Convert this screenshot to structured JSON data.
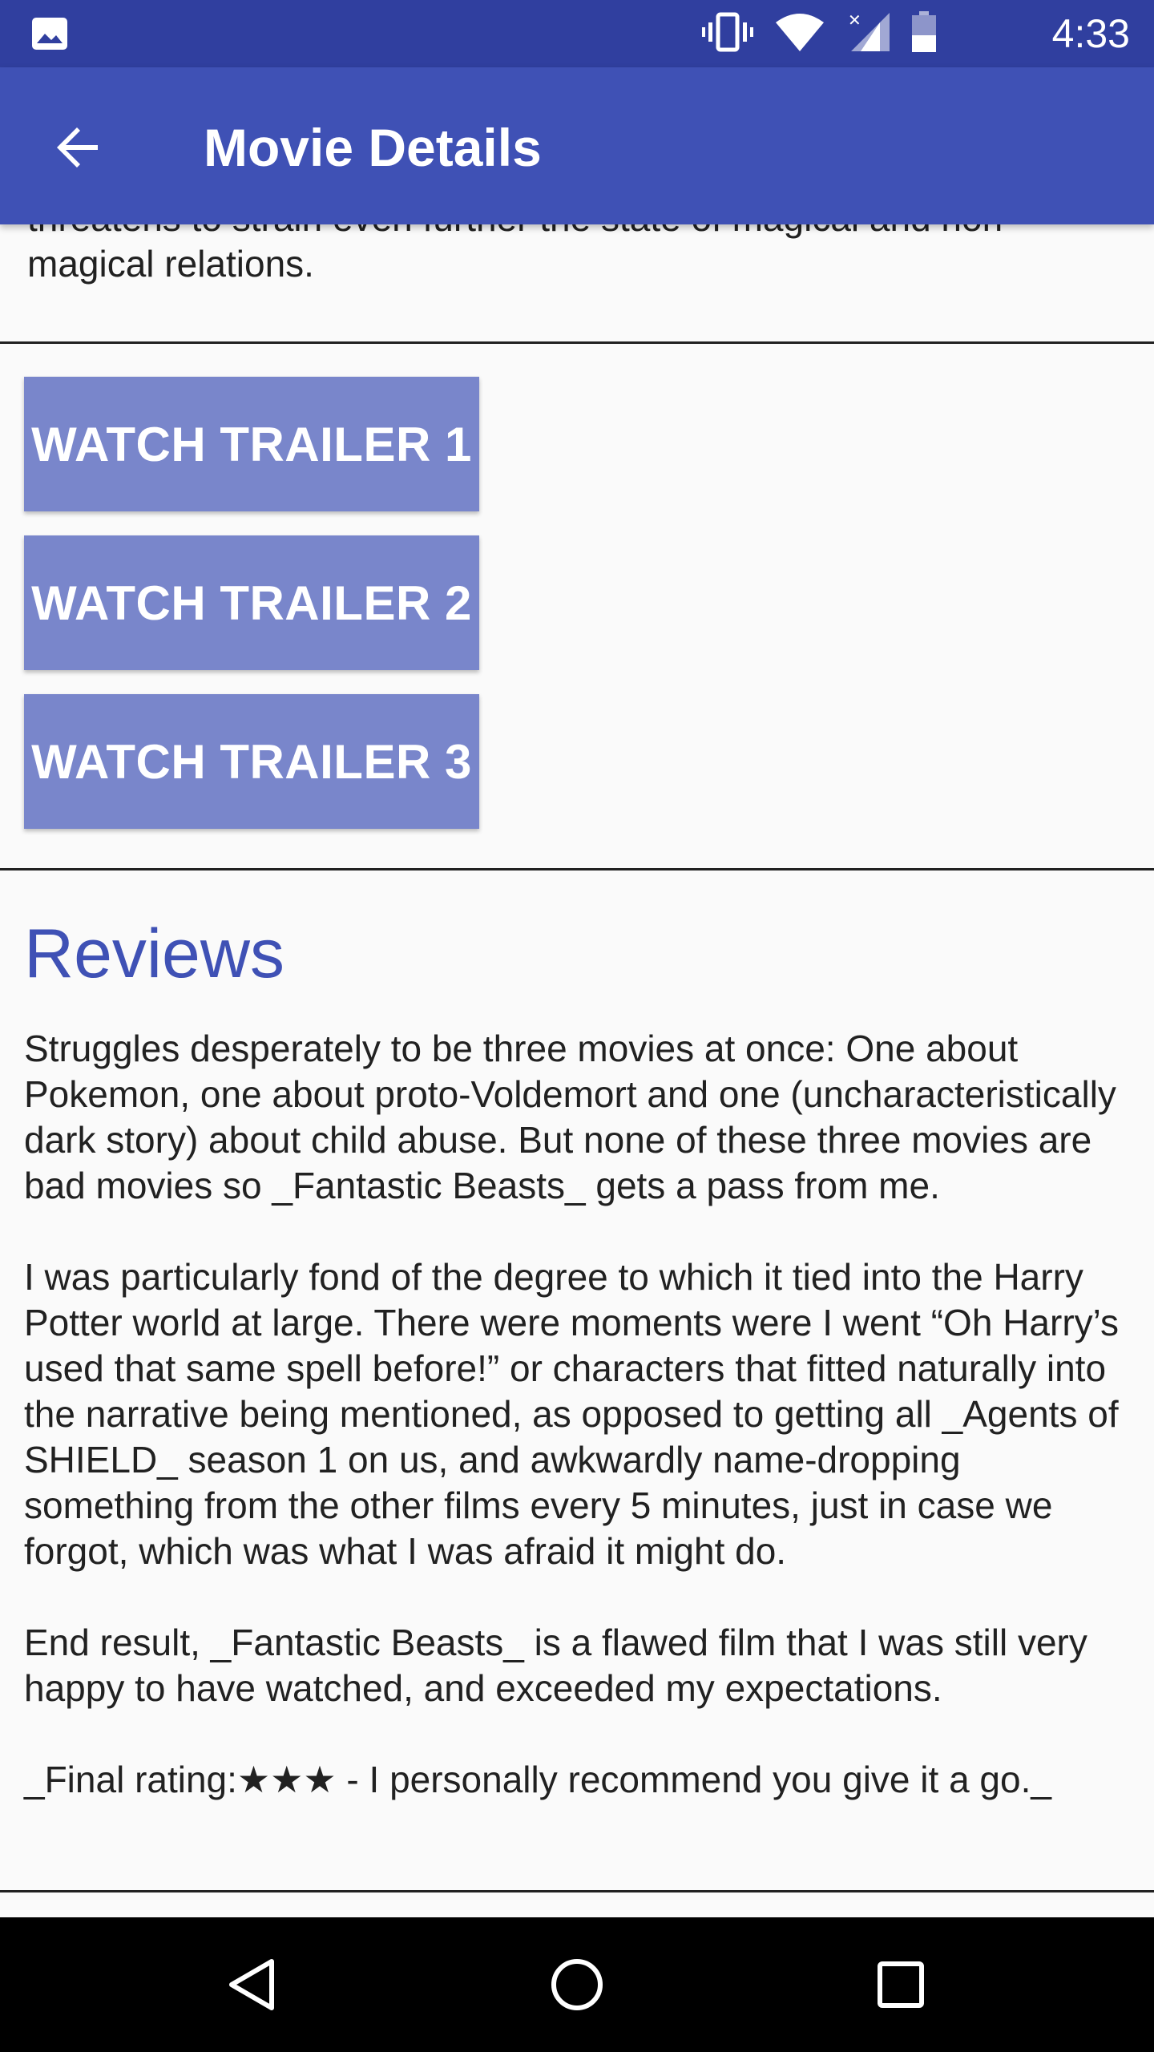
{
  "status_bar": {
    "time": "4:33",
    "icons": [
      "image-icon",
      "vibrate-icon",
      "wifi-icon",
      "signal-icon",
      "battery-icon"
    ]
  },
  "app_bar": {
    "title": "Movie Details",
    "back_icon": "arrow-back-icon",
    "background": "#3f51b5"
  },
  "overview": {
    "cut_line": "threatens to strain even further the state of magical and non-",
    "last_line": "magical relations."
  },
  "trailers": {
    "buttons": [
      {
        "label": "WATCH TRAILER 1"
      },
      {
        "label": "WATCH TRAILER 2"
      },
      {
        "label": "WATCH TRAILER 3"
      }
    ],
    "button_color": "#7986cb"
  },
  "reviews": {
    "heading": "Reviews",
    "heading_color": "#3f51b5",
    "paragraphs": [
      "Struggles desperately to be three movies at once: One about Pokemon, one about proto-Voldemort and one (uncharacteristically dark story) about child abuse. But none of these three movies are bad movies so _Fantastic Beasts_ gets a pass from me.",
      "I was particularly fond of the degree to which it tied into the Harry Potter world at large. There were moments were I went “Oh Harry’s used that same spell before!” or characters that fit­ted naturally into the narrative being mentioned, as opposed to getting all _Agents of SHIELD_ season 1 on us, and awkwardly name-dropping something from the other films every 5 minutes, just in case we forgot, which was what I was afraid it might do.",
      "End result, _Fantastic Beasts_ is a flawed film that I was still very happy to have watched, and exceeded my expectations.",
      "_Final rating:★★★ - I personally recommend you give it a go._"
    ]
  },
  "nav_bar": {
    "icons": [
      "back-triangle-icon",
      "home-circle-icon",
      "recents-square-icon"
    ]
  }
}
